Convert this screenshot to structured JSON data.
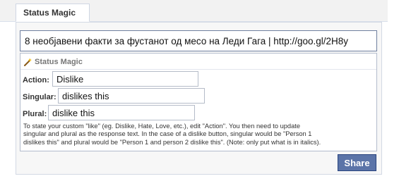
{
  "tab": {
    "label": "Status Magic"
  },
  "status": {
    "value": "8 необјавени факти за фустанот од месо на Леди Гага | http://goo.gl/2H8y"
  },
  "app": {
    "title": "Status Magic",
    "icon": "magic-wand-icon",
    "action": {
      "label": "Action:",
      "value": "Dislike"
    },
    "singular": {
      "label": "Singular:",
      "value": "dislikes this"
    },
    "plural": {
      "label": "Plural:",
      "value": "dislike this"
    },
    "help_lines": [
      "To state your custom \"like\" (eg. Dislike, Hate, Love, etc.), edit \"Action\". You then need to update",
      "singular and plural as the response text. In the case of a dislike button, singular would be \"Person 1",
      "dislikes this\" and plural would be \"Person 1 and person 2 dislike this\". (Note: only put what is in italics)."
    ]
  },
  "share": {
    "label": "Share"
  },
  "colors": {
    "share_button": "#5b74a8",
    "share_border": "#29447e"
  }
}
